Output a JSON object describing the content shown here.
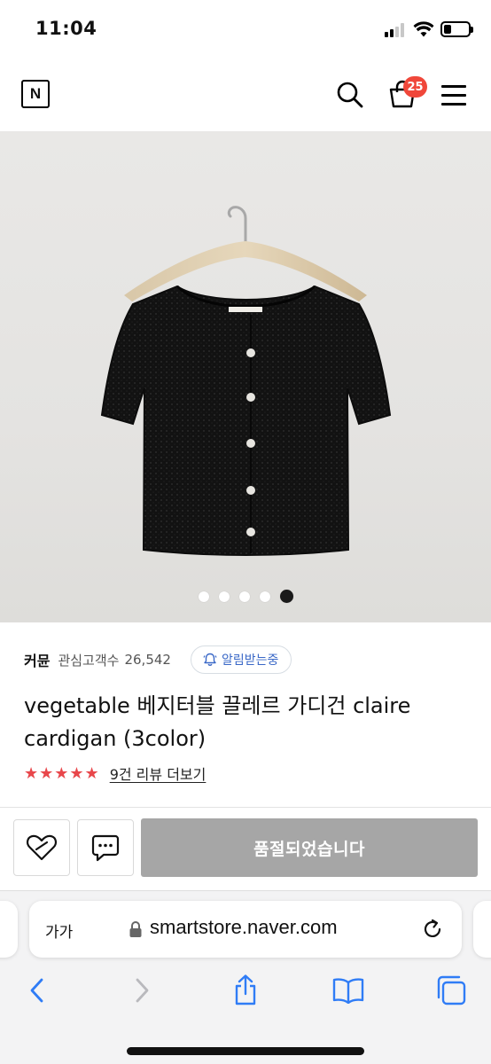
{
  "status_bar": {
    "time": "11:04"
  },
  "nav": {
    "logo": "N",
    "cart_count": "25"
  },
  "gallery": {
    "total_images": 5,
    "active_index": 5
  },
  "store": {
    "name": "커뮨",
    "favorite_label": "관심고객수",
    "favorite_count": "26,542",
    "alarm_label": "알림받는중"
  },
  "product": {
    "title": "vegetable 베지터블 끌레르 가디건 claire cardigan (3color)",
    "rating_stars": "★★★★★",
    "rating_value": 5,
    "review_link": "9건 리뷰 더보기"
  },
  "actions": {
    "soldout_label": "품절되었습니다"
  },
  "browser": {
    "text_size_label": "가가",
    "url": "smartstore.naver.com"
  },
  "colors": {
    "badge": "#f0473a",
    "stars": "#e8474b",
    "alarm_text": "#3a68c7",
    "soldout_button": "#a6a6a6"
  },
  "icons": [
    "wifi-icon",
    "battery-icon",
    "search-icon",
    "cart-icon",
    "hamburger-menu-icon",
    "bell-icon",
    "heart-icon",
    "chat-icon",
    "lock-icon",
    "reload-icon",
    "back-icon",
    "forward-icon",
    "share-icon",
    "bookmarks-icon",
    "tabs-icon"
  ]
}
